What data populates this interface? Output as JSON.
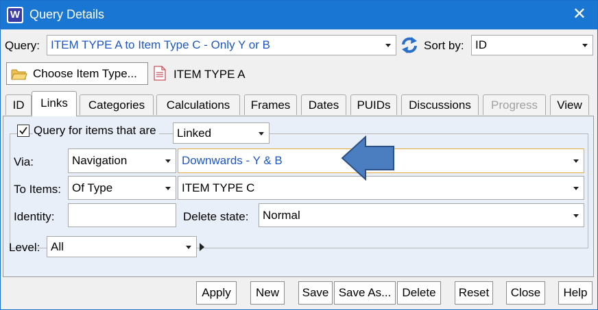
{
  "window": {
    "title": "Query Details",
    "close_glyph": "✕",
    "app_icon_letter": "W"
  },
  "query": {
    "label": "Query:",
    "value": "ITEM TYPE A to Item Type C - Only Y or B"
  },
  "sort": {
    "label": "Sort by:",
    "value": "ID"
  },
  "choose_button": {
    "label": "Choose Item Type..."
  },
  "item_type": {
    "value": "ITEM TYPE A"
  },
  "tabs": [
    {
      "label": "ID"
    },
    {
      "label": "Links"
    },
    {
      "label": "Categories"
    },
    {
      "label": "Calculations"
    },
    {
      "label": "Frames"
    },
    {
      "label": "Dates"
    },
    {
      "label": "PUIDs"
    },
    {
      "label": "Discussions"
    },
    {
      "label": "Progress"
    },
    {
      "label": "View"
    }
  ],
  "links": {
    "check_label": "Query for items that are",
    "check_value": "Linked",
    "checked": true,
    "via_label": "Via:",
    "via_type": "Navigation",
    "via_value": "Downwards - Y & B",
    "to_items_label": "To Items:",
    "to_items_type": "Of Type",
    "to_items_value": "ITEM TYPE C",
    "identity_label": "Identity:",
    "identity_value": "",
    "delete_state_label": "Delete state:",
    "delete_state_value": "Normal",
    "level_label": "Level:",
    "level_value": "All"
  },
  "buttons": {
    "apply": "Apply",
    "new": "New",
    "save": "Save",
    "save_as": "Save As...",
    "delete": "Delete",
    "reset": "Reset",
    "close": "Close",
    "help": "Help"
  },
  "colors": {
    "titlebar": "#1976d2",
    "accent_text": "#1f56c2",
    "arrow": "#4a7ec0",
    "highlight_border": "#e8a840"
  }
}
